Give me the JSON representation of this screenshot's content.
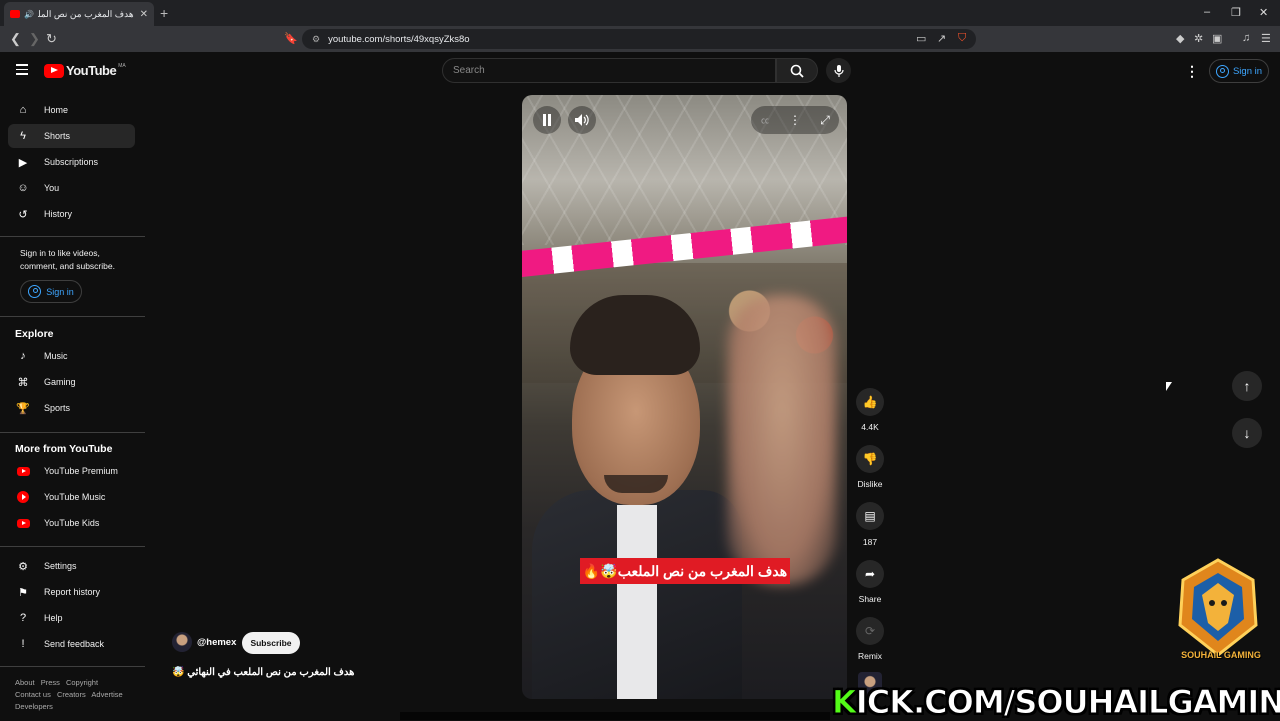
{
  "browser": {
    "tab_title": "هدف المغرب من نص الملعب",
    "new_tab": "+",
    "url": "youtube.com/shorts/49xqsyZks8o",
    "window_controls": [
      "–",
      "❐",
      "✕"
    ]
  },
  "header": {
    "logo_text": "YouTube",
    "logo_country": "MA",
    "search_placeholder": "Search",
    "signin_label": "Sign in"
  },
  "sidebar": {
    "primary": [
      {
        "label": "Home",
        "icon": "home-icon"
      },
      {
        "label": "Shorts",
        "icon": "shorts-icon"
      },
      {
        "label": "Subscriptions",
        "icon": "subscriptions-icon"
      },
      {
        "label": "You",
        "icon": "you-icon"
      },
      {
        "label": "History",
        "icon": "history-icon"
      }
    ],
    "signin_message": "Sign in to like videos, comment, and subscribe.",
    "signin_label": "Sign in",
    "explore_heading": "Explore",
    "explore": [
      {
        "label": "Music",
        "icon": "music-icon"
      },
      {
        "label": "Gaming",
        "icon": "gaming-icon"
      },
      {
        "label": "Sports",
        "icon": "sports-icon"
      }
    ],
    "more_heading": "More from YouTube",
    "more": [
      {
        "label": "YouTube Premium",
        "icon": "youtube-premium-icon"
      },
      {
        "label": "YouTube Music",
        "icon": "youtube-music-icon"
      },
      {
        "label": "YouTube Kids",
        "icon": "youtube-kids-icon"
      }
    ],
    "settings": [
      {
        "label": "Settings",
        "icon": "gear-icon"
      },
      {
        "label": "Report history",
        "icon": "flag-icon"
      },
      {
        "label": "Help",
        "icon": "help-icon"
      },
      {
        "label": "Send feedback",
        "icon": "feedback-icon"
      }
    ],
    "footer_links": [
      "About",
      "Press",
      "Copyright",
      "Contact us",
      "Creators",
      "Advertise",
      "Developers"
    ]
  },
  "short": {
    "caption": "هدف المغرب من نص الملعب🤯🔥",
    "channel": "@hemex",
    "subscribe_label": "Subscribe",
    "title": "هدف المغرب من نص الملعب في النهائي 🤯",
    "actions": {
      "likes": "4.4K",
      "dislike_label": "Dislike",
      "comments": "187",
      "share_label": "Share",
      "remix_label": "Remix"
    }
  },
  "overlay": {
    "kick_k": "K",
    "kick_rest": "ICK.COM/SOUHAILGAMING",
    "badge_text": "SOUHAIL GAMING"
  },
  "colors": {
    "accent_blue": "#3ea6ff",
    "youtube_red": "#ff0000",
    "kick_green": "#53fc18",
    "background": "#0f0f0f"
  }
}
